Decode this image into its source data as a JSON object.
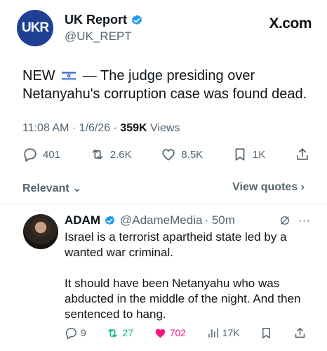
{
  "post": {
    "avatar_text": "UKR",
    "author_name": "UK Report",
    "handle": "@UK_REPT",
    "site_label": "X.com",
    "text_prefix": "NEW",
    "text_body": "— The judge presiding over Netanyahu's corruption case was found dead.",
    "time": "11:08 AM · 1/6/26 ·",
    "views_count": "359K",
    "views_label": "Views",
    "replies": "401",
    "reposts": "2.6K",
    "likes": "8.5K",
    "bookmarks": "1K"
  },
  "sort": {
    "relevant_label": "Relevant",
    "view_quotes_label": "View quotes"
  },
  "reply": {
    "author_name": "ADAM",
    "handle": "@AdameMedia",
    "age": "· 50m",
    "paragraph1": "Israel is a terrorist apartheid state led by a wanted war criminal.",
    "paragraph2": "It should have been Netanyahu who was abducted in the middle of the night. And then sentenced to hang.",
    "replies": "9",
    "reposts": "27",
    "likes": "702",
    "views": "17K"
  },
  "colors": {
    "verified_blue": "#1d9bf0",
    "muted_text": "#536471",
    "repost_green": "#00ba7c",
    "like_pink": "#f91880"
  }
}
